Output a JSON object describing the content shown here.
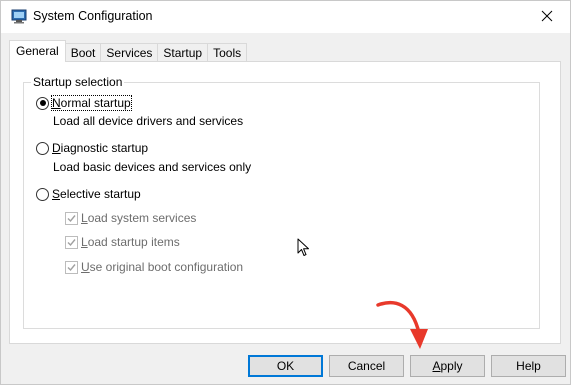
{
  "window": {
    "title": "System Configuration",
    "icon": "msconfig-icon",
    "close_glyph": "✕"
  },
  "tabs": [
    {
      "label": "General",
      "active": true
    },
    {
      "label": "Boot",
      "active": false
    },
    {
      "label": "Services",
      "active": false
    },
    {
      "label": "Startup",
      "active": false
    },
    {
      "label": "Tools",
      "active": false
    }
  ],
  "startup_selection": {
    "group_label": "Startup selection",
    "normal": {
      "label_hotkey": "N",
      "label_rest": "ormal startup",
      "description": "Load all device drivers and services",
      "selected": true
    },
    "diagnostic": {
      "label_hotkey": "D",
      "label_rest": "iagnostic startup",
      "description": "Load basic devices and services only",
      "selected": false
    },
    "selective": {
      "label_hotkey": "S",
      "label_rest": "elective startup",
      "selected": false,
      "options": {
        "system_services": {
          "label_hotkey": "L",
          "label_rest": "oad system services",
          "checked": true,
          "enabled": false
        },
        "startup_items": {
          "label_hotkey": "L",
          "label_rest": "oad startup items",
          "checked": true,
          "enabled": false
        },
        "original_boot": {
          "label_hotkey": "U",
          "label_rest": "se original boot configuration",
          "checked": true,
          "enabled": false
        }
      }
    }
  },
  "buttons": {
    "ok": "OK",
    "cancel": "Cancel",
    "apply_hotkey": "A",
    "apply_rest": "pply",
    "help": "Help"
  },
  "colors": {
    "accent": "#0078d7",
    "annotation_arrow": "#e8392b",
    "disabled_text": "#6d6d6d"
  }
}
